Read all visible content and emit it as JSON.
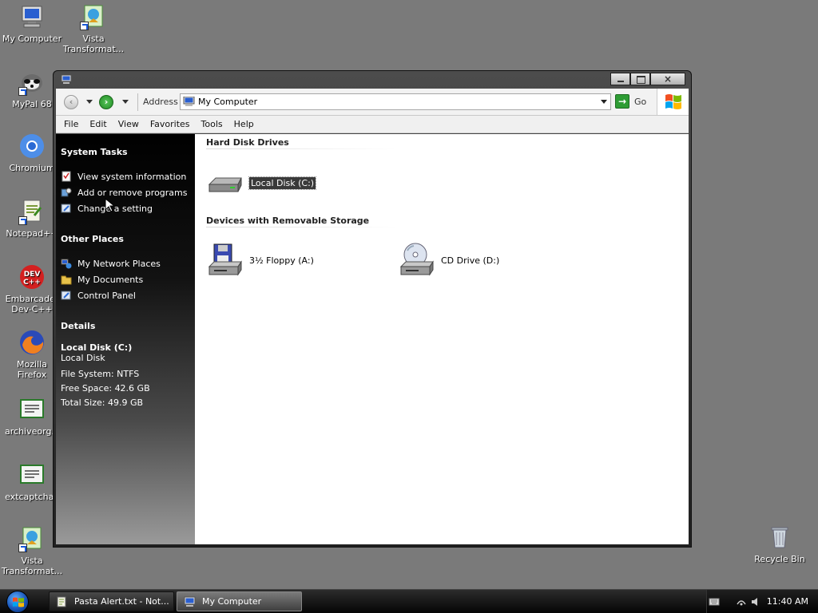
{
  "desktop": {
    "icons": [
      {
        "label": "My Computer",
        "icon": "my-computer-icon"
      },
      {
        "label": "Vista\nTransformat...",
        "icon": "vista-transformation-icon"
      },
      {
        "label": "MyPal 68",
        "icon": "mypal-icon"
      },
      {
        "label": "Chromium",
        "icon": "chromium-icon"
      },
      {
        "label": "Notepad++",
        "icon": "notepad-plus-plus-icon"
      },
      {
        "label": "Embarcader\nDev-C++",
        "icon": "dev-cpp-icon"
      },
      {
        "label": "Mozilla\nFirefox",
        "icon": "firefox-icon"
      },
      {
        "label": "archiveorg.c",
        "icon": "certificate-icon"
      },
      {
        "label": "extcaptchay",
        "icon": "certificate-icon"
      },
      {
        "label": "Vista\nTransformat...",
        "icon": "vista-transformation-icon"
      },
      {
        "label": "Recycle Bin",
        "icon": "recycle-bin-icon"
      }
    ],
    "devcpp_badge": "DEV\nC++"
  },
  "window": {
    "title": "",
    "title_buttons": {
      "close_glyph": "×"
    },
    "address_label": "Address",
    "address_value": "My Computer",
    "go_label": "Go",
    "menu": [
      "File",
      "Edit",
      "View",
      "Favorites",
      "Tools",
      "Help"
    ],
    "taskpane": {
      "system_tasks": {
        "title": "System Tasks",
        "items": [
          "View system information",
          "Add or remove programs",
          "Change a setting"
        ]
      },
      "other_places": {
        "title": "Other Places",
        "items": [
          "My Network Places",
          "My Documents",
          "Control Panel"
        ]
      },
      "details": {
        "title": "Details",
        "name": "Local Disk (C:)",
        "type": "Local Disk",
        "file_system": "File System: NTFS",
        "free_space": "Free Space: 42.6 GB",
        "total_size": "Total Size: 49.9 GB"
      }
    },
    "groups": [
      {
        "title": "Hard Disk Drives",
        "items": [
          {
            "label": "Local Disk (C:)",
            "icon": "hard-disk-icon",
            "selected": true
          }
        ]
      },
      {
        "title": "Devices with Removable Storage",
        "items": [
          {
            "label": "3½ Floppy (A:)",
            "icon": "floppy-drive-icon",
            "selected": false
          },
          {
            "label": "CD Drive (D:)",
            "icon": "cd-drive-icon",
            "selected": false
          }
        ]
      }
    ]
  },
  "taskbar": {
    "buttons": [
      {
        "label": "Pasta Alert.txt - Not...",
        "active": false
      },
      {
        "label": "My Computer",
        "active": true
      }
    ],
    "clock": "11:40 AM"
  },
  "colors": {
    "desktop": "#7a7a7a",
    "taskpane_top": "#000000",
    "selection": "#3a3a3a",
    "go_green": "#2e9c34"
  }
}
